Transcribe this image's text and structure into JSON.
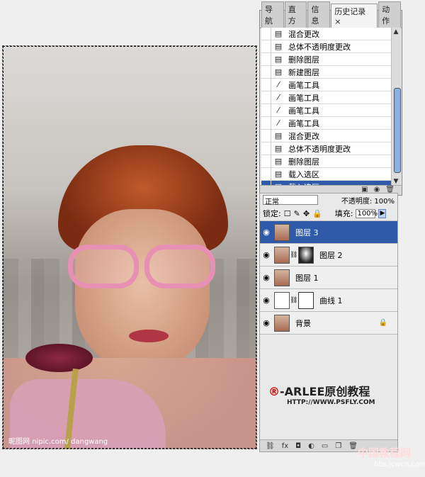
{
  "history_panel": {
    "tabs": [
      "导航",
      "直方",
      "信息",
      "历史记录 ×",
      "动作"
    ],
    "items": [
      {
        "label": "混合更改",
        "icon": "history-state-icon",
        "selected": false
      },
      {
        "label": "总体不透明度更改",
        "icon": "history-state-icon",
        "selected": false
      },
      {
        "label": "删除图层",
        "icon": "history-state-icon",
        "selected": false
      },
      {
        "label": "新建图层",
        "icon": "history-state-icon",
        "selected": false
      },
      {
        "label": "画笔工具",
        "icon": "brush-icon",
        "selected": false
      },
      {
        "label": "画笔工具",
        "icon": "brush-icon",
        "selected": false
      },
      {
        "label": "画笔工具",
        "icon": "brush-icon",
        "selected": false
      },
      {
        "label": "画笔工具",
        "icon": "brush-icon",
        "selected": false
      },
      {
        "label": "混合更改",
        "icon": "history-state-icon",
        "selected": false
      },
      {
        "label": "总体不透明度更改",
        "icon": "history-state-icon",
        "selected": false
      },
      {
        "label": "删除图层",
        "icon": "history-state-icon",
        "selected": false
      },
      {
        "label": "载入选区",
        "icon": "history-state-icon",
        "selected": false
      },
      {
        "label": "载入选区",
        "icon": "history-state-icon",
        "selected": true
      }
    ]
  },
  "layers_panel": {
    "mode": "正常",
    "opacity_label": "不透明度:",
    "opacity_value": "100%",
    "lock_label": "锁定:",
    "fill_label": "填充:",
    "fill_value": "100%",
    "layers": [
      {
        "name": "图层 3",
        "active": true,
        "thumbs": [
          "photo"
        ],
        "locked": false
      },
      {
        "name": "图层 2",
        "active": false,
        "thumbs": [
          "photo",
          "mask2"
        ],
        "locked": false
      },
      {
        "name": "图层 1",
        "active": false,
        "thumbs": [
          "photo"
        ],
        "locked": false
      },
      {
        "name": "曲线 1",
        "active": false,
        "thumbs": [
          "curve",
          "mask"
        ],
        "locked": false
      },
      {
        "name": "背景",
        "active": false,
        "thumbs": [
          "photo"
        ],
        "locked": true
      }
    ]
  },
  "watermark": {
    "symbol": "®",
    "title": "-ARLEE原创教程",
    "url": "HTTP://WWW.PSFLY.COM"
  },
  "canvas": {
    "credit": "昵图网 nipic.com/ dangwang"
  },
  "site_credit": {
    "name": "中国教程网",
    "url": "bbs.jcwcn.com"
  }
}
